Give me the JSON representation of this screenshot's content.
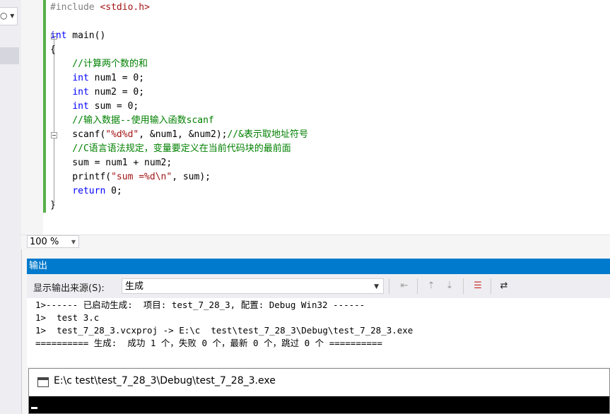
{
  "sidebar": {
    "combo_glyph": "○ ▾"
  },
  "editor": {
    "lines": [
      [
        {
          "t": "#include <stdio.h>",
          "c": "pp"
        }
      ],
      [],
      [
        {
          "t": "int",
          "c": "kw"
        },
        {
          "t": " main()",
          "c": ""
        }
      ],
      [
        {
          "t": "{",
          "c": ""
        }
      ],
      [
        {
          "t": "    //计算两个数的和",
          "c": "cm"
        }
      ],
      [
        {
          "t": "    ",
          "c": ""
        },
        {
          "t": "int",
          "c": "kw"
        },
        {
          "t": " num1 = 0;",
          "c": ""
        }
      ],
      [
        {
          "t": "    ",
          "c": ""
        },
        {
          "t": "int",
          "c": "kw"
        },
        {
          "t": " num2 = 0;",
          "c": ""
        }
      ],
      [
        {
          "t": "    ",
          "c": ""
        },
        {
          "t": "int",
          "c": "kw"
        },
        {
          "t": " sum = 0;",
          "c": ""
        }
      ],
      [
        {
          "t": "    //输入数据--使用输入函数scanf",
          "c": "cm"
        }
      ],
      [
        {
          "t": "    scanf(",
          "c": ""
        },
        {
          "t": "\"%d%d\"",
          "c": "st"
        },
        {
          "t": ", &num1, &num2);",
          "c": ""
        },
        {
          "t": "//&表示取地址符号",
          "c": "cm"
        }
      ],
      [
        {
          "t": "    //C语言语法规定，变量要定义在当前代码块的最前面",
          "c": "cm"
        }
      ],
      [
        {
          "t": "    sum = num1 + num2;",
          "c": ""
        }
      ],
      [
        {
          "t": "    printf(",
          "c": ""
        },
        {
          "t": "\"sum =%d\\n\"",
          "c": "st"
        },
        {
          "t": ", sum);",
          "c": ""
        }
      ],
      [
        {
          "t": "    ",
          "c": ""
        },
        {
          "t": "return",
          "c": "kw"
        },
        {
          "t": " 0;",
          "c": ""
        }
      ],
      [
        {
          "t": "}",
          "c": ""
        }
      ]
    ]
  },
  "zoom": {
    "value": "100 %",
    "arrow": "▼"
  },
  "output": {
    "title": "输出",
    "source_label": "显示输出来源(S):",
    "source_value": "生成",
    "source_arrow": "▼",
    "lines": [
      "1>------ 已启动生成:  项目: test_7_28_3, 配置: Debug Win32 ------",
      "1>  test 3.c",
      "1>  test_7_28_3.vcxproj -> E:\\c  test\\test_7_28_3\\Debug\\test_7_28_3.exe",
      "========== 生成:  成功 1 个，失败 0 个，最新 0 个，跳过 0 个 =========="
    ],
    "toolbar_icons": [
      {
        "name": "find-message-icon",
        "glyph": "⇤"
      },
      {
        "name": "go-previous-message-icon",
        "glyph": "⇡"
      },
      {
        "name": "go-next-message-icon",
        "glyph": "⇣"
      },
      {
        "name": "clear-all-icon",
        "glyph": "☰"
      },
      {
        "name": "word-wrap-icon",
        "glyph": "⇄"
      }
    ]
  },
  "console": {
    "title": "E:\\c  test\\test_7_28_3\\Debug\\test_7_28_3.exe"
  }
}
